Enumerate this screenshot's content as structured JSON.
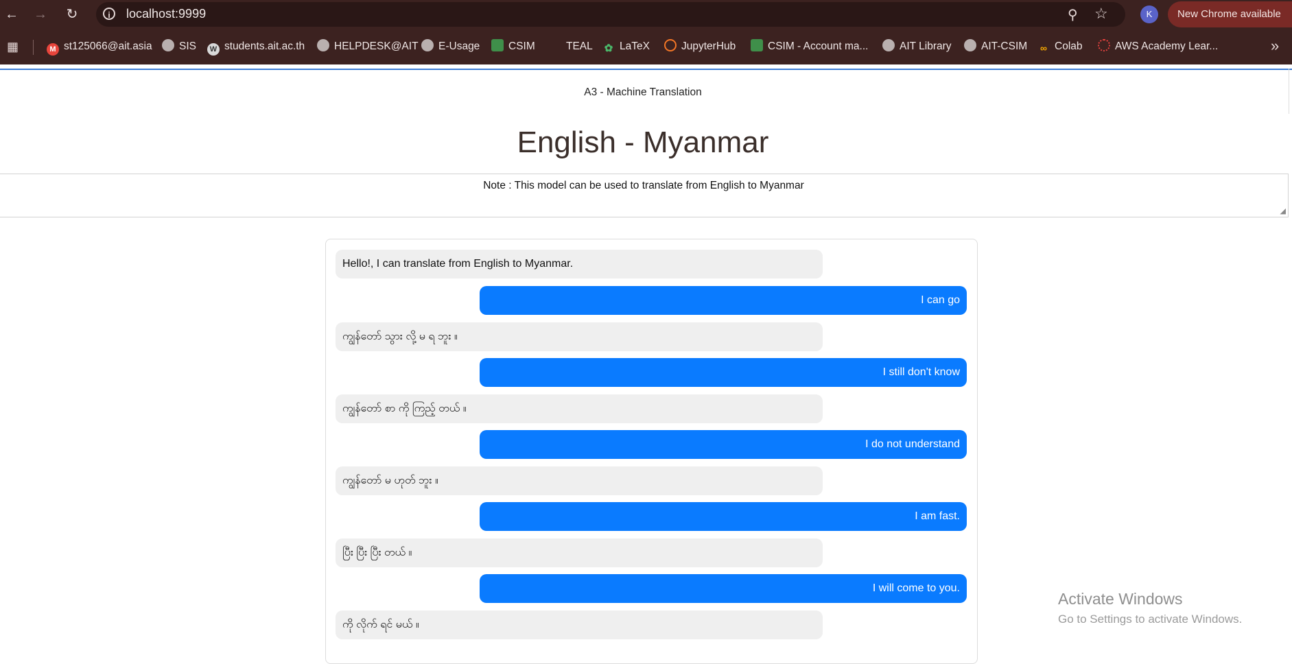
{
  "browser": {
    "url": "localhost:9999",
    "profile_initial": "K",
    "update_label": "New Chrome available",
    "bookmarks": [
      {
        "label": "st125066@ait.asia",
        "icon": "gmail-icon"
      },
      {
        "label": "SIS",
        "icon": "globe-icon"
      },
      {
        "label": "students.ait.ac.th",
        "icon": "wordpress-icon"
      },
      {
        "label": "HELPDESK@AIT",
        "icon": "globe-icon"
      },
      {
        "label": "E-Usage",
        "icon": "globe-icon"
      },
      {
        "label": "CSIM",
        "icon": "csim-icon"
      },
      {
        "label": "TEAL",
        "icon": "blank-icon"
      },
      {
        "label": "LaTeX",
        "icon": "overleaf-icon"
      },
      {
        "label": "JupyterHub",
        "icon": "jupyter-icon"
      },
      {
        "label": "CSIM - Account ma...",
        "icon": "csim-account-icon"
      },
      {
        "label": "AIT Library",
        "icon": "globe-icon"
      },
      {
        "label": "AIT-CSIM",
        "icon": "globe-icon"
      },
      {
        "label": "Colab",
        "icon": "colab-icon"
      },
      {
        "label": "AWS Academy Lear...",
        "icon": "aws-academy-icon"
      }
    ]
  },
  "page": {
    "subtitle": "A3 - Machine Translation",
    "title": "English - Myanmar",
    "note": "Note : This model can be used to translate from English to Myanmar"
  },
  "chat": {
    "messages": [
      {
        "role": "bot",
        "text": "Hello!, I can translate from English to Myanmar."
      },
      {
        "role": "user",
        "text": "I can go"
      },
      {
        "role": "bot",
        "text": "ကျွန်တော် သွား လို့ မ ရ ဘူး ။"
      },
      {
        "role": "user",
        "text": "I still don't know"
      },
      {
        "role": "bot",
        "text": "ကျွန်တော် စာ ကို ကြည့် တယ် ။"
      },
      {
        "role": "user",
        "text": "I do not understand"
      },
      {
        "role": "bot",
        "text": "ကျွန်တော် မ ဟုတ် ဘူး ။"
      },
      {
        "role": "user",
        "text": "I am fast."
      },
      {
        "role": "bot",
        "text": "ပြီး ပြီး ပြီး တယ် ။"
      },
      {
        "role": "user",
        "text": "I will come to you."
      },
      {
        "role": "bot",
        "text": "ကို လိုက် ရင် မယ် ။"
      }
    ]
  },
  "os": {
    "watermark_title": "Activate Windows",
    "watermark_sub": "Go to Settings to activate Windows."
  },
  "colors": {
    "user_bubble": "#0a7bff",
    "bot_bubble": "#efefef",
    "browser_frame": "#3c2220"
  }
}
